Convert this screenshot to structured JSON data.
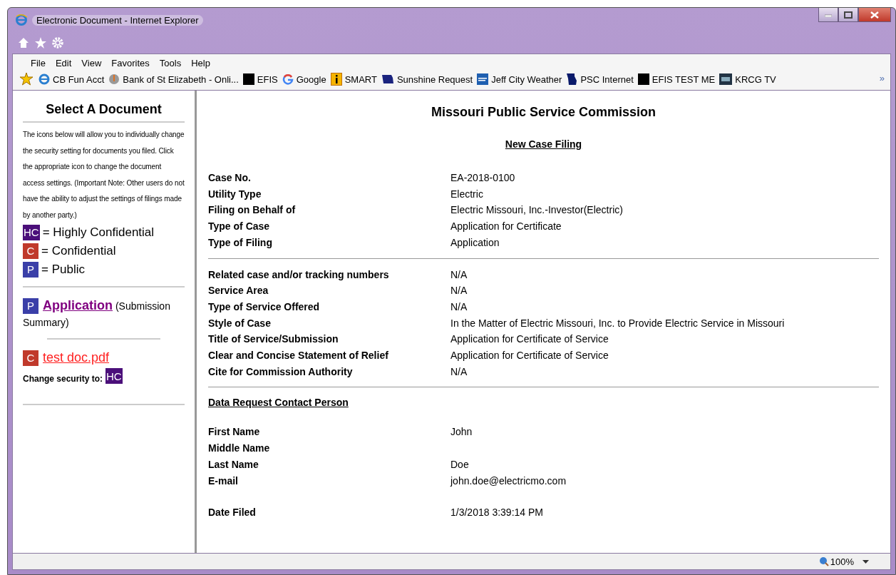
{
  "window": {
    "title": "Electronic Document - Internet Explorer"
  },
  "menu": [
    "File",
    "Edit",
    "View",
    "Favorites",
    "Tools",
    "Help"
  ],
  "favorites": [
    {
      "label": "CB Fun Acct",
      "kind": "ie"
    },
    {
      "label": "Bank of St Elizabeth - Onli...",
      "kind": "bank"
    },
    {
      "label": "EFIS",
      "kind": "black"
    },
    {
      "label": "Google",
      "kind": "google"
    },
    {
      "label": "SMART",
      "kind": "info"
    },
    {
      "label": "Sunshine Request",
      "kind": "my"
    },
    {
      "label": "Jeff City Weather",
      "kind": "weather"
    },
    {
      "label": "PSC Internet",
      "kind": "state"
    },
    {
      "label": "EFIS TEST ME",
      "kind": "black"
    },
    {
      "label": "KRCG TV",
      "kind": "tv"
    }
  ],
  "overflow": "»",
  "sidebar": {
    "title": "Select A Document",
    "intro": "The icons below will allow you to individually change the security setting for documents you filed. Click the appropriate icon to change the document access settings. (Important Note: Other users do not have the ability to adjust the settings of filings made by another party.)",
    "legend": [
      {
        "badge": "HC",
        "label": "= Highly Confidential",
        "color": "#4b0f7a"
      },
      {
        "badge": "C",
        "label": "= Confidential",
        "color": "#c0392b"
      },
      {
        "badge": "P",
        "label": "= Public",
        "color": "#3a3fa8"
      }
    ],
    "documents": [
      {
        "badge": "P",
        "color": "#3a3fa8",
        "link": "Application",
        "kind": "main",
        "note": [
          "(Submission",
          "Summary)"
        ]
      },
      {
        "badge": "C",
        "color": "#c0392b",
        "link": "test doc.pdf",
        "kind": "attachment",
        "change_to": {
          "label": "Change security to:",
          "badge": "HC",
          "color": "#4b0f7a"
        }
      }
    ]
  },
  "document": {
    "title": "Missouri Public Service Commission",
    "subtitle": "New Case Filing",
    "groups": [
      {
        "rows": [
          {
            "label": "Case No.",
            "value": "EA-2018-0100"
          },
          {
            "label": "Utility Type",
            "value": "Electric"
          },
          {
            "label": "Filing on Behalf of",
            "value": "Electric Missouri, Inc.-Investor(Electric)"
          },
          {
            "label": "Type of Case",
            "value": "Application for Certificate"
          },
          {
            "label": "Type of Filing",
            "value": "Application"
          }
        ]
      },
      {
        "rows": [
          {
            "label": "Related case and/or tracking numbers",
            "value": "N/A"
          },
          {
            "label": "Service Area",
            "value": "N/A"
          },
          {
            "label": "Type of Service Offered",
            "value": "N/A"
          },
          {
            "label": "Style of Case",
            "value": "In the Matter of Electric Missouri, Inc. to Provide Electric Service in Missouri"
          },
          {
            "label": "Title of Service/Submission",
            "value": "Application for Certificate of Service"
          },
          {
            "label": "Clear and Concise Statement of Relief",
            "value": "Application for Certificate of Service"
          },
          {
            "label": "Cite for Commission Authority",
            "value": "N/A"
          }
        ]
      }
    ],
    "contact": {
      "heading": "Data Request Contact Person",
      "rows": [
        {
          "label": "First Name",
          "value": "John"
        },
        {
          "label": "Middle Name"
        },
        {
          "label": "Last Name",
          "value": "Doe"
        },
        {
          "label": "E-mail",
          "value": "john.doe@electricmo.com"
        }
      ]
    },
    "date": {
      "label": "Date Filed",
      "value": "1/3/2018 3:39:14 PM"
    }
  },
  "status_bar": {
    "zoom": "100%"
  }
}
